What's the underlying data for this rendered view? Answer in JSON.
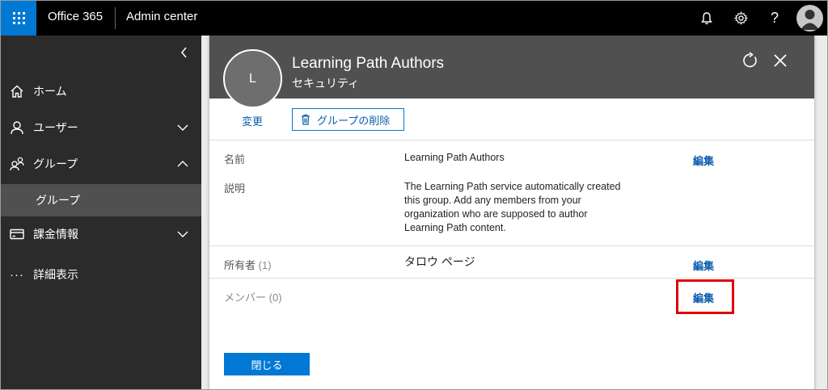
{
  "topbar": {
    "brand": "Office 365",
    "app_name": "Admin center",
    "icons": [
      "app-launcher-icon",
      "bell-icon",
      "gear-icon",
      "help-icon",
      "user-avatar-icon"
    ],
    "help_glyph": "?"
  },
  "sidebar": {
    "items": [
      {
        "label": "ホーム",
        "icon": "home-icon"
      },
      {
        "label": "ユーザー",
        "icon": "user-icon",
        "expandable": true
      },
      {
        "label": "グループ",
        "icon": "group-icon",
        "expanded": true
      },
      {
        "label": "グループ",
        "sub": true,
        "selected": true
      },
      {
        "label": "課金情報",
        "icon": "billing-icon",
        "expandable": true
      },
      {
        "label": "詳細表示",
        "icon": "more-icon"
      }
    ],
    "more_glyph": "···"
  },
  "panel": {
    "initial": "L",
    "title": "Learning Path Authors",
    "subtitle": "セキュリティ",
    "commands": {
      "change": "変更",
      "delete_group": "グループの削除"
    },
    "fields": {
      "name_label": "名前",
      "name_value": "Learning Path Authors",
      "name_edit": "編集",
      "description_label": "説明",
      "description_lines": [
        "The Learning Path service automatically created",
        "this group. Add any members from your",
        "organization who are supposed to author",
        "Learning Path content."
      ],
      "owners_label": "所有者",
      "owners_count": "(1)",
      "owners_value": "タロウ ページ",
      "owners_edit": "編集",
      "members_label": "メンバー",
      "members_count": "(0)",
      "members_edit": "編集"
    },
    "close_button": "閉じる"
  },
  "colors": {
    "accent": "#0078d4",
    "topbar": "#000000",
    "sidebar": "#2b2b2b",
    "panel_header": "#505050",
    "highlight": "#e00000"
  }
}
